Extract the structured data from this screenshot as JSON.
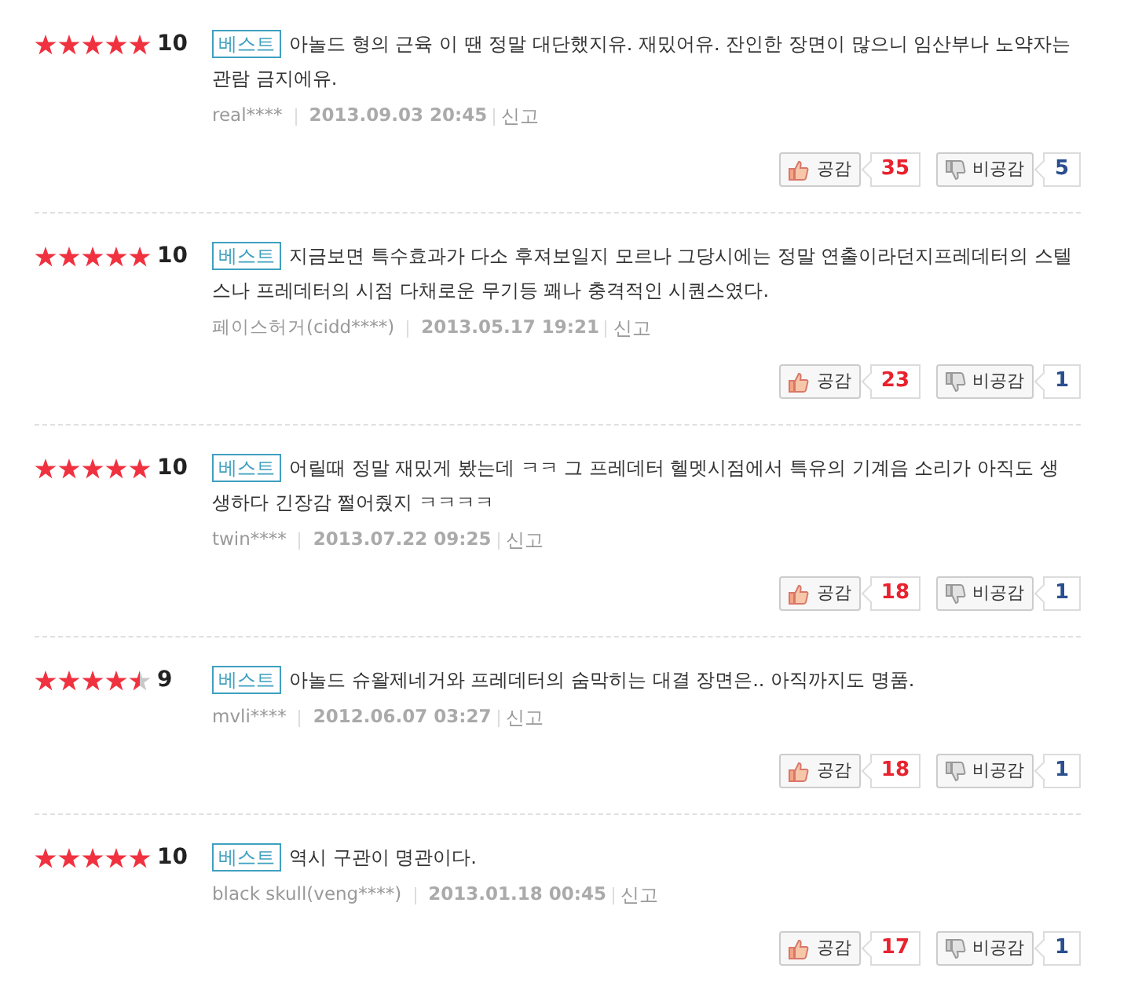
{
  "reviews": [
    {
      "stars": 5,
      "score": "10",
      "badge": "베스트",
      "text": "아놀드 형의 근육 이 땐 정말 대단했지유. 재밌어유. 잔인한 장면이 많으니 임산부나 노약자는 관람 금지에유.",
      "user": "real****",
      "date": "2013.09.03 20:45",
      "report": "신고",
      "like_label": "공감",
      "likes": "35",
      "dislike_label": "비공감",
      "dislikes": "5"
    },
    {
      "stars": 5,
      "score": "10",
      "badge": "베스트",
      "text": "지금보면 특수효과가 다소 후져보일지 모르나 그당시에는 정말 연출이라던지프레데터의 스텔스나 프레데터의 시점 다채로운 무기등 꽤나 충격적인 시퀀스였다.",
      "user": "페이스허거(cidd****)",
      "date": "2013.05.17 19:21",
      "report": "신고",
      "like_label": "공감",
      "likes": "23",
      "dislike_label": "비공감",
      "dislikes": "1"
    },
    {
      "stars": 5,
      "score": "10",
      "badge": "베스트",
      "text": "어릴때 정말 재밌게 봤는데 ㅋㅋ 그 프레데터 헬멧시점에서 특유의 기계음 소리가 아직도 생생하다 긴장감 쩔어줬지 ㅋㅋㅋㅋ",
      "user": "twin****",
      "date": "2013.07.22 09:25",
      "report": "신고",
      "like_label": "공감",
      "likes": "18",
      "dislike_label": "비공감",
      "dislikes": "1"
    },
    {
      "stars": 4.5,
      "score": "9",
      "badge": "베스트",
      "text": "아놀드 슈왈제네거와 프레데터의 숨막히는 대결 장면은.. 아직까지도 명품.",
      "user": "mvli****",
      "date": "2012.06.07 03:27",
      "report": "신고",
      "like_label": "공감",
      "likes": "18",
      "dislike_label": "비공감",
      "dislikes": "1"
    },
    {
      "stars": 5,
      "score": "10",
      "badge": "베스트",
      "text": "역시 구관이 명관이다.",
      "user": "black skull(veng****)",
      "date": "2013.01.18 00:45",
      "report": "신고",
      "like_label": "공감",
      "likes": "17",
      "dislike_label": "비공감",
      "dislikes": "1"
    }
  ]
}
